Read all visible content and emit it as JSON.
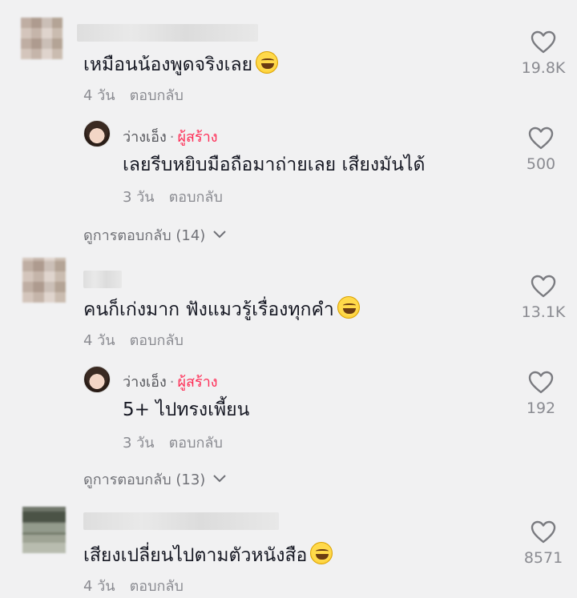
{
  "comments": [
    {
      "text": "เหมือนน้องพูดจริงเลย",
      "emoji": "sweat-smile-emoji",
      "time": "4 วัน",
      "reply_label": "ตอบกลับ",
      "likes": "19.8K",
      "creator_reply": {
        "name": "ว่างเอ็ง",
        "dot": "·",
        "badge": "ผู้สร้าง",
        "text": "เลยรีบหยิบมือถือมาถ่ายเลย เสียงมันได้",
        "time": "3 วัน",
        "reply_label": "ตอบกลับ",
        "likes": "500"
      },
      "view_replies": "ดูการตอบกลับ (14)"
    },
    {
      "text": "คนก็เก่งมาก ฟังแมวรู้เรื่องทุกคำ",
      "emoji": "laughing-tears-emoji",
      "time": "4 วัน",
      "reply_label": "ตอบกลับ",
      "likes": "13.1K",
      "creator_reply": {
        "name": "ว่างเอ็ง",
        "dot": "·",
        "badge": "ผู้สร้าง",
        "text": "5+ ไปทรงเพี้ยน",
        "time": "3 วัน",
        "reply_label": "ตอบกลับ",
        "likes": "192"
      },
      "view_replies": "ดูการตอบกลับ (13)"
    },
    {
      "text": "เสียงเปลี่ยนไปตามตัวหนังสือ",
      "emoji": "laughing-tears-emoji",
      "time": "4 วัน",
      "reply_label": "ตอบกลับ",
      "likes": "8571"
    }
  ],
  "colors": {
    "background": "#f1f1f2",
    "creator_badge": "#fe2c55",
    "meta_text": "#8a8b91"
  }
}
